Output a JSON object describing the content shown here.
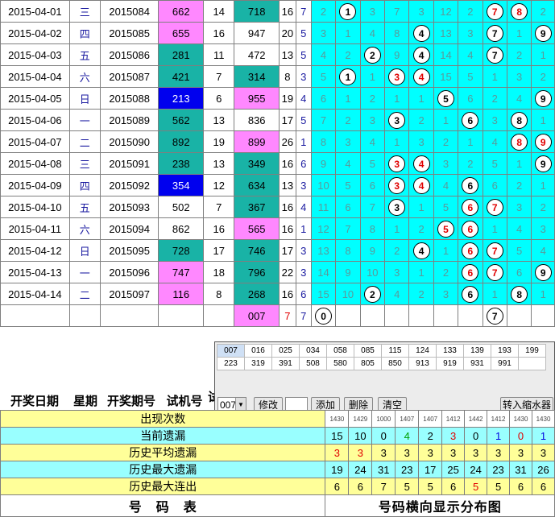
{
  "rows": [
    {
      "date": "2015-04-01",
      "week": "三",
      "period": "2015084",
      "trial": "662",
      "trial_bg": "pink",
      "span": "14",
      "num": "718",
      "num_bg": "teal",
      "sum": "16",
      "small": "7",
      "cells": [
        {
          "t": "2"
        },
        {
          "t": "1",
          "b": true
        },
        {
          "t": "3"
        },
        {
          "t": "7"
        },
        {
          "t": "3"
        },
        {
          "t": "12"
        },
        {
          "t": "2"
        },
        {
          "t": "7",
          "b": true,
          "r": true
        },
        {
          "t": "8",
          "b": true,
          "r": true
        },
        {
          "t": "2"
        }
      ]
    },
    {
      "date": "2015-04-02",
      "week": "四",
      "period": "2015085",
      "trial": "655",
      "trial_bg": "pink",
      "span": "16",
      "num": "947",
      "num_bg": "",
      "sum": "20",
      "small": "5",
      "cells": [
        {
          "t": "3"
        },
        {
          "t": "1"
        },
        {
          "t": "4"
        },
        {
          "t": "8"
        },
        {
          "t": "4",
          "b": true
        },
        {
          "t": "13"
        },
        {
          "t": "3"
        },
        {
          "t": "7",
          "b": true
        },
        {
          "t": "1"
        },
        {
          "t": "9",
          "b": true
        }
      ]
    },
    {
      "date": "2015-04-03",
      "week": "五",
      "period": "2015086",
      "trial": "281",
      "trial_bg": "teal",
      "span": "11",
      "num": "472",
      "num_bg": "",
      "sum": "13",
      "small": "5",
      "cells": [
        {
          "t": "4"
        },
        {
          "t": "2"
        },
        {
          "t": "2",
          "b": true
        },
        {
          "t": "9"
        },
        {
          "t": "4",
          "b": true
        },
        {
          "t": "14"
        },
        {
          "t": "4"
        },
        {
          "t": "7",
          "b": true
        },
        {
          "t": "2"
        },
        {
          "t": "1"
        }
      ]
    },
    {
      "date": "2015-04-04",
      "week": "六",
      "period": "2015087",
      "trial": "421",
      "trial_bg": "teal",
      "span": "7",
      "num": "314",
      "num_bg": "teal",
      "sum": "8",
      "small": "3",
      "cells": [
        {
          "t": "5"
        },
        {
          "t": "1",
          "b": true
        },
        {
          "t": "1"
        },
        {
          "t": "3",
          "b": true,
          "r": true
        },
        {
          "t": "4",
          "b": true,
          "r": true
        },
        {
          "t": "15"
        },
        {
          "t": "5"
        },
        {
          "t": "1"
        },
        {
          "t": "3"
        },
        {
          "t": "2"
        }
      ]
    },
    {
      "date": "2015-04-05",
      "week": "日",
      "period": "2015088",
      "trial": "213",
      "trial_bg": "blue",
      "span": "6",
      "num": "955",
      "num_bg": "pink",
      "sum": "19",
      "small": "4",
      "cells": [
        {
          "t": "6"
        },
        {
          "t": "1"
        },
        {
          "t": "2"
        },
        {
          "t": "1"
        },
        {
          "t": "1"
        },
        {
          "t": "5",
          "b": true
        },
        {
          "t": "6"
        },
        {
          "t": "2"
        },
        {
          "t": "4"
        },
        {
          "t": "9",
          "b": true
        }
      ]
    },
    {
      "date": "2015-04-06",
      "week": "一",
      "period": "2015089",
      "trial": "562",
      "trial_bg": "teal",
      "span": "13",
      "num": "836",
      "num_bg": "",
      "sum": "17",
      "small": "5",
      "cells": [
        {
          "t": "7"
        },
        {
          "t": "2"
        },
        {
          "t": "3"
        },
        {
          "t": "3",
          "b": true
        },
        {
          "t": "2"
        },
        {
          "t": "1"
        },
        {
          "t": "6",
          "b": true
        },
        {
          "t": "3"
        },
        {
          "t": "8",
          "b": true
        },
        {
          "t": "1"
        }
      ]
    },
    {
      "date": "2015-04-07",
      "week": "二",
      "period": "2015090",
      "trial": "892",
      "trial_bg": "teal",
      "span": "19",
      "num": "899",
      "num_bg": "pink",
      "sum": "26",
      "small": "1",
      "cells": [
        {
          "t": "8"
        },
        {
          "t": "3"
        },
        {
          "t": "4"
        },
        {
          "t": "1"
        },
        {
          "t": "3"
        },
        {
          "t": "2"
        },
        {
          "t": "1"
        },
        {
          "t": "4"
        },
        {
          "t": "8",
          "b": true,
          "r": true
        },
        {
          "t": "9",
          "b": true,
          "r": true
        }
      ]
    },
    {
      "date": "2015-04-08",
      "week": "三",
      "period": "2015091",
      "trial": "238",
      "trial_bg": "teal",
      "span": "13",
      "num": "349",
      "num_bg": "teal",
      "sum": "16",
      "small": "6",
      "cells": [
        {
          "t": "9"
        },
        {
          "t": "4"
        },
        {
          "t": "5"
        },
        {
          "t": "3",
          "b": true,
          "r": true
        },
        {
          "t": "4",
          "b": true,
          "r": true
        },
        {
          "t": "3"
        },
        {
          "t": "2"
        },
        {
          "t": "5"
        },
        {
          "t": "1"
        },
        {
          "t": "9",
          "b": true
        }
      ]
    },
    {
      "date": "2015-04-09",
      "week": "四",
      "period": "2015092",
      "trial": "354",
      "trial_bg": "blue",
      "span": "12",
      "num": "634",
      "num_bg": "teal",
      "sum": "13",
      "small": "3",
      "cells": [
        {
          "t": "10"
        },
        {
          "t": "5"
        },
        {
          "t": "6"
        },
        {
          "t": "3",
          "b": true,
          "r": true
        },
        {
          "t": "4",
          "b": true,
          "r": true
        },
        {
          "t": "4"
        },
        {
          "t": "6",
          "b": true
        },
        {
          "t": "6"
        },
        {
          "t": "2"
        },
        {
          "t": "1"
        }
      ]
    },
    {
      "date": "2015-04-10",
      "week": "五",
      "period": "2015093",
      "trial": "502",
      "trial_bg": "",
      "span": "7",
      "num": "367",
      "num_bg": "teal",
      "sum": "16",
      "small": "4",
      "cells": [
        {
          "t": "11"
        },
        {
          "t": "6"
        },
        {
          "t": "7"
        },
        {
          "t": "3",
          "b": true
        },
        {
          "t": "1"
        },
        {
          "t": "5"
        },
        {
          "t": "6",
          "b": true,
          "r": true
        },
        {
          "t": "7",
          "b": true,
          "r": true
        },
        {
          "t": "3"
        },
        {
          "t": "2"
        }
      ]
    },
    {
      "date": "2015-04-11",
      "week": "六",
      "period": "2015094",
      "trial": "862",
      "trial_bg": "",
      "span": "16",
      "num": "565",
      "num_bg": "pink",
      "sum": "16",
      "small": "1",
      "cells": [
        {
          "t": "12"
        },
        {
          "t": "7"
        },
        {
          "t": "8"
        },
        {
          "t": "1"
        },
        {
          "t": "2"
        },
        {
          "t": "5",
          "b": true,
          "r": true
        },
        {
          "t": "6",
          "b": true,
          "r": true
        },
        {
          "t": "1"
        },
        {
          "t": "4"
        },
        {
          "t": "3"
        }
      ]
    },
    {
      "date": "2015-04-12",
      "week": "日",
      "period": "2015095",
      "trial": "728",
      "trial_bg": "teal",
      "span": "17",
      "num": "746",
      "num_bg": "teal",
      "sum": "17",
      "small": "3",
      "cells": [
        {
          "t": "13"
        },
        {
          "t": "8"
        },
        {
          "t": "9"
        },
        {
          "t": "2"
        },
        {
          "t": "4",
          "b": true
        },
        {
          "t": "1"
        },
        {
          "t": "6",
          "b": true,
          "r": true
        },
        {
          "t": "7",
          "b": true,
          "r": true
        },
        {
          "t": "5"
        },
        {
          "t": "4"
        }
      ]
    },
    {
      "date": "2015-04-13",
      "week": "一",
      "period": "2015096",
      "trial": "747",
      "trial_bg": "pink",
      "span": "18",
      "num": "796",
      "num_bg": "teal",
      "sum": "22",
      "small": "3",
      "cells": [
        {
          "t": "14"
        },
        {
          "t": "9"
        },
        {
          "t": "10"
        },
        {
          "t": "3"
        },
        {
          "t": "1"
        },
        {
          "t": "2"
        },
        {
          "t": "6",
          "b": true,
          "r": true
        },
        {
          "t": "7",
          "b": true,
          "r": true
        },
        {
          "t": "6"
        },
        {
          "t": "9",
          "b": true
        }
      ]
    },
    {
      "date": "2015-04-14",
      "week": "二",
      "period": "2015097",
      "trial": "116",
      "trial_bg": "pink",
      "span": "8",
      "num": "268",
      "num_bg": "teal",
      "sum": "16",
      "small": "6",
      "cells": [
        {
          "t": "15"
        },
        {
          "t": "10"
        },
        {
          "t": "2",
          "b": true
        },
        {
          "t": "4"
        },
        {
          "t": "2"
        },
        {
          "t": "3"
        },
        {
          "t": "6",
          "b": true
        },
        {
          "t": "1"
        },
        {
          "t": "8",
          "b": true
        },
        {
          "t": "1"
        }
      ]
    }
  ],
  "pending": {
    "num": "007",
    "sum": "7",
    "small": "7",
    "balls": [
      {
        "col": 0,
        "t": "0"
      },
      {
        "col": 7,
        "t": "7"
      }
    ]
  },
  "panel": {
    "numbers_row1": [
      "007",
      "016",
      "025",
      "034",
      "058",
      "085",
      "115",
      "124",
      "133",
      "139",
      "193",
      "199"
    ],
    "numbers_row2": [
      "223",
      "319",
      "391",
      "508",
      "580",
      "805",
      "850",
      "913",
      "919",
      "931",
      "991",
      ""
    ],
    "combo_value": "007",
    "btn_modify": "修改",
    "btn_add": "添加",
    "btn_delete": "删除",
    "btn_clear": "清空",
    "btn_shrink": "转入缩水器"
  },
  "headers": {
    "date": "开奖日期",
    "week": "星期",
    "period": "开奖期号",
    "trial": "试机号",
    "cut": "试"
  },
  "stats": {
    "small_header": [
      "1430",
      "1429",
      "1000",
      "1407",
      "1407",
      "1412",
      "1442",
      "1412",
      "1430",
      "1430"
    ],
    "rows": [
      {
        "label": "出现次数",
        "style": "y",
        "values": []
      },
      {
        "label": "当前遗漏",
        "style": "c",
        "values": [
          "15",
          "10",
          "0",
          "4",
          "2",
          "3",
          "0",
          "1",
          "0",
          "1"
        ],
        "colors": [
          "b",
          "b",
          "b",
          "g",
          "b",
          "r",
          "b",
          "bl",
          "r",
          "bl"
        ]
      },
      {
        "label": "历史平均遗漏",
        "style": "y",
        "values": [
          "3",
          "3",
          "3",
          "3",
          "3",
          "3",
          "3",
          "3",
          "3",
          "3"
        ],
        "colors": [
          "r",
          "r",
          "b",
          "b",
          "b",
          "b",
          "b",
          "b",
          "b",
          "b"
        ]
      },
      {
        "label": "历史最大遗漏",
        "style": "c",
        "values": [
          "19",
          "24",
          "31",
          "23",
          "17",
          "25",
          "24",
          "23",
          "31",
          "26"
        ],
        "colors": []
      },
      {
        "label": "历史最大连出",
        "style": "y",
        "values": [
          "6",
          "6",
          "7",
          "5",
          "5",
          "6",
          "5",
          "5",
          "6",
          "6"
        ],
        "colors": [
          "b",
          "b",
          "b",
          "b",
          "b",
          "b",
          "r",
          "b",
          "b",
          "b"
        ]
      }
    ],
    "foot_left": "号　码　表",
    "foot_right": "号码横向显示分布图"
  }
}
